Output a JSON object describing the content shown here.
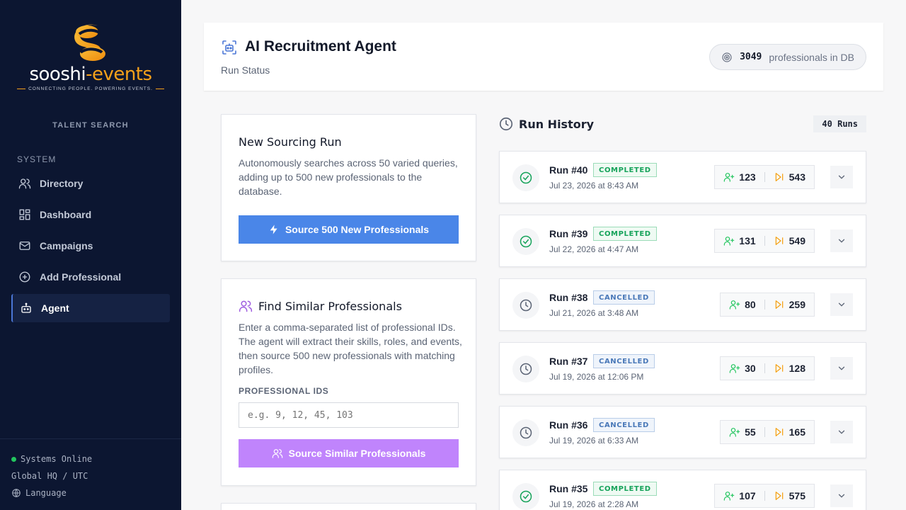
{
  "brand": {
    "word_main": "sooshi",
    "word_accent": "-events",
    "tagline": "CONNECTING PEOPLE. POWERING EVENTS."
  },
  "sidebar": {
    "section_top": "TALENT SEARCH",
    "section_system": "SYSTEM",
    "items": [
      {
        "label": "Directory",
        "icon": "users-icon"
      },
      {
        "label": "Dashboard",
        "icon": "dashboard-icon"
      },
      {
        "label": "Campaigns",
        "icon": "mail-icon"
      },
      {
        "label": "Add Professional",
        "icon": "plus-circle-icon"
      },
      {
        "label": "Agent",
        "icon": "bot-icon",
        "active": true
      }
    ],
    "footer": {
      "status": "Systems Online",
      "region": "Global HQ / UTC",
      "language": "Language"
    }
  },
  "header": {
    "title": "AI Recruitment Agent",
    "subtitle": "Run Status",
    "db_count": "3049",
    "db_label": "professionals in DB"
  },
  "sourcing": {
    "title": "New Sourcing Run",
    "description": "Autonomously searches across 50 varied queries, adding up to 500 new professionals to the database.",
    "button": "Source 500 New Professionals"
  },
  "similar": {
    "title": "Find Similar Professionals",
    "description": "Enter a comma-separated list of professional IDs. The agent will extract their skills, roles, and events, then source 500 new professionals with matching profiles.",
    "field_label": "PROFESSIONAL IDS",
    "placeholder": "e.g. 9, 12, 45, 103",
    "button": "Source Similar Professionals"
  },
  "history": {
    "title": "Run History",
    "count": "40 Runs",
    "runs": [
      {
        "title": "Run #40",
        "status": "COMPLETED",
        "date": "Jul 23, 2026 at 8:43 AM",
        "added": "123",
        "skipped": "543"
      },
      {
        "title": "Run #39",
        "status": "COMPLETED",
        "date": "Jul 22, 2026 at 4:47 AM",
        "added": "131",
        "skipped": "549"
      },
      {
        "title": "Run #38",
        "status": "CANCELLED",
        "date": "Jul 21, 2026 at 3:48 AM",
        "added": "80",
        "skipped": "259"
      },
      {
        "title": "Run #37",
        "status": "CANCELLED",
        "date": "Jul 19, 2026 at 12:06 PM",
        "added": "30",
        "skipped": "128"
      },
      {
        "title": "Run #36",
        "status": "CANCELLED",
        "date": "Jul 19, 2026 at 6:33 AM",
        "added": "55",
        "skipped": "165"
      },
      {
        "title": "Run #35",
        "status": "COMPLETED",
        "date": "Jul 19, 2026 at 2:28 AM",
        "added": "107",
        "skipped": "575"
      }
    ]
  },
  "colors": {
    "sidebar_bg": "#0c1631",
    "primary_button": "#4a86e8",
    "similar_button": "#c084fc",
    "completed": "#16a35a",
    "cancelled": "#4978b8",
    "skipped": "#f59e0b",
    "added": "#22c55e"
  }
}
